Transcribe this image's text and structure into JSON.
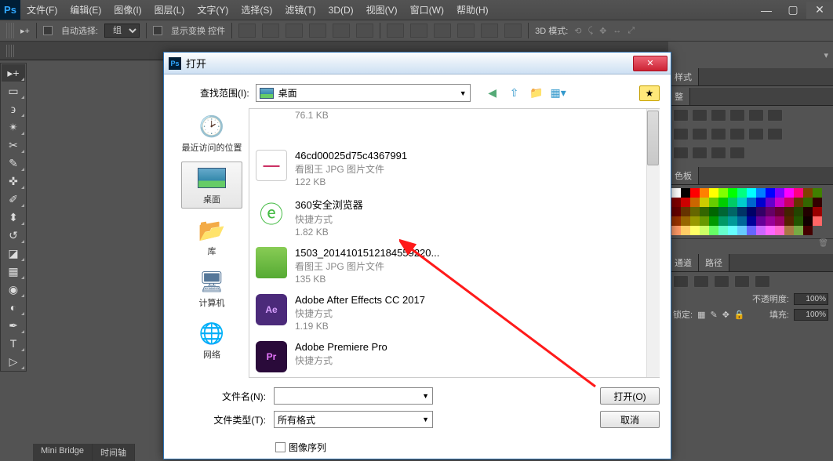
{
  "app": {
    "logo": "Ps"
  },
  "menubar": {
    "file": "文件(F)",
    "edit": "编辑(E)",
    "image": "图像(I)",
    "layer": "图层(L)",
    "type": "文字(Y)",
    "select": "选择(S)",
    "filter": "滤镜(T)",
    "3d": "3D(D)",
    "view": "视图(V)",
    "window": "窗口(W)",
    "help": "帮助(H)"
  },
  "options": {
    "auto_select": "自动选择:",
    "group": "组",
    "show_transform": "显示变换 控件",
    "mode3d": "3D 模式:"
  },
  "bottom": {
    "mini_bridge": "Mini Bridge",
    "timeline": "时间轴"
  },
  "right": {
    "style": "样式",
    "adjust": "整",
    "swatch_tab": "色板",
    "channel": "通道",
    "path": "路径",
    "opacity_label": "不透明度:",
    "opacity": "100%",
    "lock_label": "锁定:",
    "fill_label": "填充:",
    "fill": "100%"
  },
  "dialog": {
    "title": "打开",
    "lookup_label": "查找范围(I):",
    "lookup_value": "桌面",
    "places": {
      "recent": "最近访问的位置",
      "desktop": "桌面",
      "library": "库",
      "computer": "计算机",
      "network": "网络"
    },
    "files": [
      {
        "name": "",
        "desc": "",
        "size": "76.1 KB",
        "thumb": "blank"
      },
      {
        "name": "46cd00025d75c4367991",
        "desc": "看图王 JPG 图片文件",
        "size": "122 KB",
        "thumb": "banner"
      },
      {
        "name": "360安全浏览器",
        "desc": "快捷方式",
        "size": "1.82 KB",
        "thumb": "360"
      },
      {
        "name": "1503_2014101512184559220...",
        "desc": "看图王 JPG 图片文件",
        "size": "135 KB",
        "thumb": "photo"
      },
      {
        "name": "Adobe After Effects CC 2017",
        "desc": "快捷方式",
        "size": "1.19 KB",
        "thumb": "ae"
      },
      {
        "name": "Adobe Premiere Pro",
        "desc": "快捷方式",
        "size": "",
        "thumb": "pr"
      }
    ],
    "filename_label": "文件名(N):",
    "filename_value": "",
    "filetype_label": "文件类型(T):",
    "filetype_value": "所有格式",
    "open_btn": "打开(O)",
    "cancel_btn": "取消",
    "image_seq": "图像序列"
  }
}
